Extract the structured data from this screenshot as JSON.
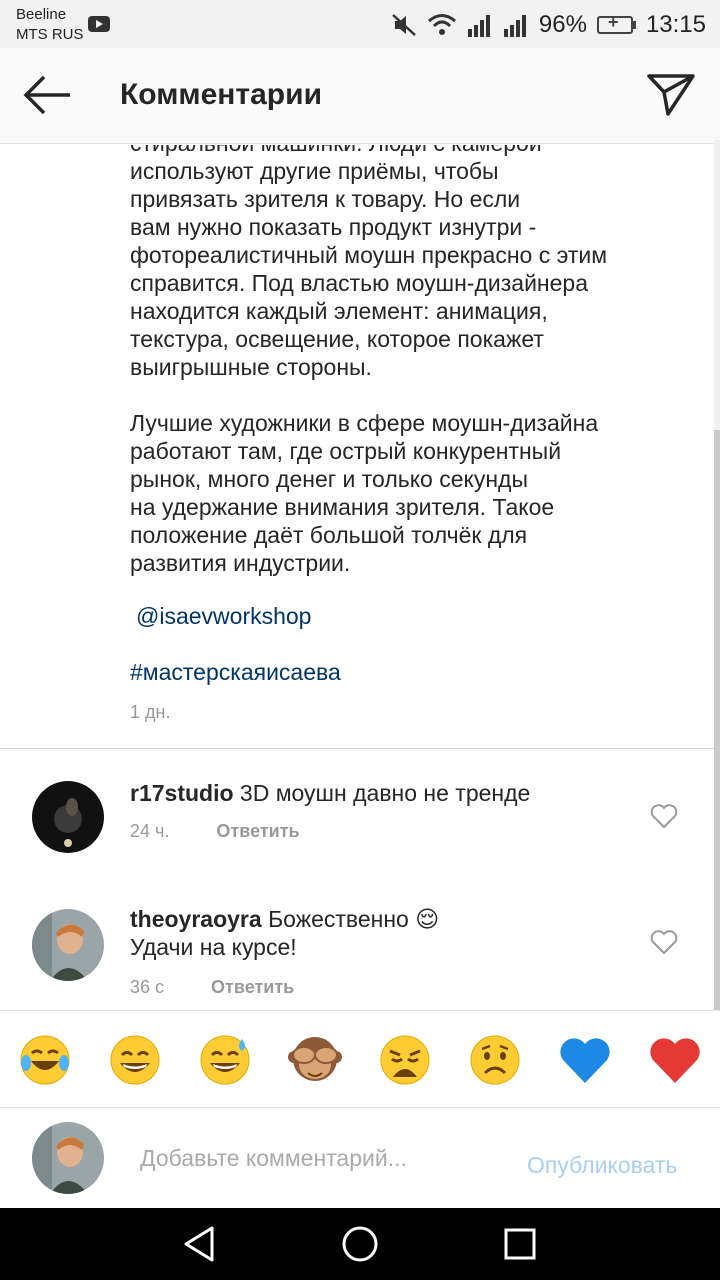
{
  "status_bar": {
    "carrier_line1": "Beeline",
    "carrier_line2": "MTS RUS",
    "battery": "96%",
    "time": "13:15",
    "icons": [
      "youtube-notification-icon",
      "mute-icon",
      "wifi-icon",
      "signal-icon",
      "signal-icon",
      "battery-icon"
    ]
  },
  "header": {
    "title": "Комментарии",
    "back_icon": "arrow-left-icon",
    "share_icon": "send-icon"
  },
  "caption": {
    "lines_top": [
      "стиральной машинки. Люди с камерой",
      "используют другие приёмы, чтобы",
      "привязать зрителя к товару. Но если",
      "вам нужно показать продукт изнутри -",
      "фотореалистичный моушн прекрасно с этим",
      "справится. Под властью моушн-дизайнера",
      "находится каждый элемент: анимация,",
      "текстура, освещение, которое покажет",
      "выигрышные стороны."
    ],
    "lines_bottom": [
      "Лучшие художники в сфере моушн-дизайна",
      "работают там, где острый конкурентный",
      "рынок, много денег и только секунды",
      "на удержание внимания зрителя. Такое",
      "положение даёт большой толчёк для",
      "развития индустрии."
    ],
    "mention": "@isaevworkshop",
    "hashtag": "#мастерскаяисаева",
    "time": "1 дн."
  },
  "comments": [
    {
      "username": "r17studio",
      "text": "3D моушн давно не тренде",
      "time": "24 ч.",
      "reply": "Ответить"
    },
    {
      "username": "theoyraoyra",
      "text": "Божественно 😌",
      "text_line2": "Удачи на курсе!",
      "time": "36 с",
      "reply": "Ответить"
    }
  ],
  "emoji_bar": {
    "emojis": [
      "😂",
      "😄",
      "😅",
      "🙈",
      "😩",
      "☹️",
      "💙",
      "❤️"
    ],
    "colors": {
      "face": "#ffcc33",
      "blue_heart": "#1e88e5",
      "red_heart": "#e53935"
    }
  },
  "composer": {
    "placeholder": "Добавьте комментарий...",
    "value": "",
    "publish_label": "Опубликовать"
  },
  "nav_bar": {
    "icons": [
      "back-triangle-icon",
      "home-circle-icon",
      "recents-square-icon"
    ]
  }
}
